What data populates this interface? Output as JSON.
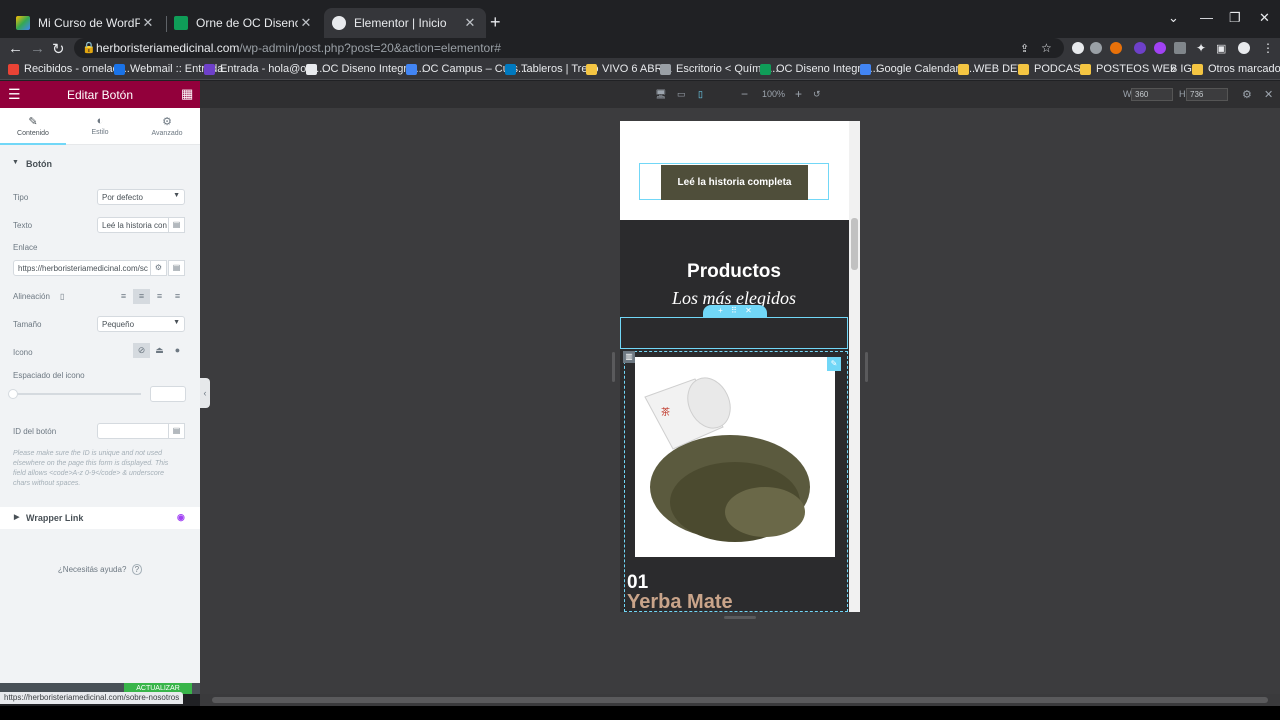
{
  "browser": {
    "tabs": [
      {
        "title": "Mi Curso de WordPress - Google",
        "favicon_color": "#fbbc04",
        "active": false
      },
      {
        "title": "Orne de OC Diseno Integral | Ma",
        "favicon_color": "#0f9d58",
        "active": false
      },
      {
        "title": "Elementor | Inicio",
        "favicon_color": "#e8eaed",
        "active": true
      }
    ],
    "new_tab": "+",
    "url_host": "herboristeriamedicinal.com",
    "url_path": "/wp-admin/post.php?post=20&action=elementor#",
    "bookmarks": [
      {
        "label": "Recibidos - ornelaci...",
        "color": "#ea4335"
      },
      {
        "label": "Webmail :: Entrada",
        "color": "#1a73e8"
      },
      {
        "label": "Entrada - hola@orn...",
        "color": "#6e40c9"
      },
      {
        "label": "OC Diseno Integral...",
        "color": "#e8eaed"
      },
      {
        "label": "OC Campus – Curs...",
        "color": "#4285f4"
      },
      {
        "label": "Tableros | Trello",
        "color": "#0079bf"
      },
      {
        "label": "VIVO 6 ABRIL",
        "color": "#f4c542"
      },
      {
        "label": "Escritorio < Químic...",
        "color": "#9aa0a6"
      },
      {
        "label": "OC Diseno Integral...",
        "color": "#0f9d58"
      },
      {
        "label": "Google Calendar -...",
        "color": "#4285f4"
      },
      {
        "label": "WEB DEV",
        "color": "#f4c542"
      },
      {
        "label": "PODCAST",
        "color": "#f4c542"
      },
      {
        "label": "POSTEOS WEB IG",
        "color": "#f4c542"
      },
      {
        "label": "»",
        "color": ""
      },
      {
        "label": "Otros marcadores",
        "color": "#f4c542"
      }
    ]
  },
  "panel": {
    "title": "Editar Botón",
    "tabs": [
      {
        "label": "Contenido",
        "icon": "pencil-icon"
      },
      {
        "label": "Estilo",
        "icon": "contrast-icon"
      },
      {
        "label": "Avanzado",
        "icon": "gear-icon"
      }
    ],
    "section_title": "Botón",
    "tipo_label": "Tipo",
    "tipo_value": "Por defecto",
    "texto_label": "Texto",
    "texto_value": "Leé la historia con",
    "enlace_label": "Enlace",
    "enlace_value": "https://herboristeriamedicinal.com/sc",
    "alineacion_label": "Alineación",
    "tamano_label": "Tamaño",
    "tamano_value": "Pequeño",
    "icono_label": "Icono",
    "espaciado_label": "Espaciado del icono",
    "id_label": "ID del botón",
    "help_text": "Please make sure the ID is unique and not used elsewhere on the page this form is displayed. This field allows <code>A-z 0-9</code> & underscore chars without spaces.",
    "wrapper_link": "Wrapper Link",
    "help_link": "¿Necesitás ayuda?",
    "update_label": "ACTUALIZAR"
  },
  "status_url": "https://herboristeriamedicinal.com/sobre-nosotros",
  "editor": {
    "zoom": "100%",
    "width_label": "W",
    "width_value": "360",
    "height_label": "H",
    "height_value": "736"
  },
  "preview": {
    "cta_label": "Leé la historia completa",
    "section_title": "Productos",
    "section_subtitle": "Los más elegidos",
    "product_number": "01",
    "product_name": "Yerba Mate"
  },
  "colors": {
    "elementor_brand": "#92003b",
    "accent": "#71d7f7",
    "cta_bg": "#4f4e3a",
    "update_green": "#39b54a"
  }
}
